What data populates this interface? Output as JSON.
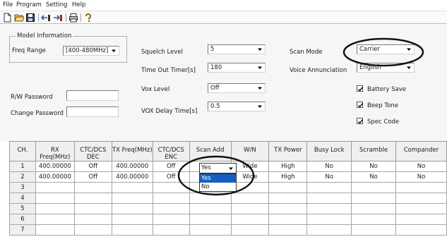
{
  "menu": [
    "File",
    "Program",
    "Setting",
    "Help"
  ],
  "toolbar": {
    "icons": [
      "new-file-icon",
      "open-folder-icon",
      "save-disk-icon",
      "read-from-radio-icon",
      "write-to-radio-icon",
      "print-icon",
      "help-about-icon"
    ]
  },
  "model_info": {
    "legend": "Model Information",
    "freq_range_label": "Freq Range",
    "freq_range_value": "[400-480MHz]"
  },
  "password": {
    "rw_label": "R/W Password",
    "rw_value": "",
    "change_label": "Change Password",
    "change_value": ""
  },
  "settings": {
    "squelch_label": "Squelch Level",
    "squelch_value": "5",
    "timeout_label": "Time Out Timer[s]",
    "timeout_value": "180",
    "vox_level_label": "Vox Level",
    "vox_level_value": "Off",
    "vox_delay_label": "VOX Delay Time[s]",
    "vox_delay_value": "0.5",
    "scan_mode_label": "Scan Mode",
    "scan_mode_value": "Carrier",
    "voice_label": "Voice Annunciation",
    "voice_value": "English"
  },
  "checkboxes": [
    {
      "label": "Battery Save",
      "checked": true
    },
    {
      "label": "Beep Tone",
      "checked": true
    },
    {
      "label": "Spec Code",
      "checked": true
    }
  ],
  "table": {
    "columns": [
      "CH.",
      "RX Freq(MHz)",
      "CTC/DCS DEC",
      "TX Freq(MHz)",
      "CTC/DCS ENC",
      "Scan Add",
      "W/N",
      "TX Power",
      "Busy Lock",
      "Scramble",
      "Compander"
    ],
    "rows": [
      [
        "1",
        "400.00000",
        "Off",
        "400.00000",
        "Off",
        "Yes",
        "Wide",
        "High",
        "No",
        "No",
        "No"
      ],
      [
        "2",
        "400.00000",
        "Off",
        "400.00000",
        "Off",
        "Yes",
        "Wide",
        "High",
        "No",
        "No",
        "No"
      ],
      [
        "3",
        "",
        "",
        "",
        "",
        "",
        "",
        "",
        "",
        "",
        ""
      ],
      [
        "4",
        "",
        "",
        "",
        "",
        "",
        "",
        "",
        "",
        "",
        ""
      ],
      [
        "5",
        "",
        "",
        "",
        "",
        "",
        "",
        "",
        "",
        "",
        ""
      ],
      [
        "6",
        "",
        "",
        "",
        "",
        "",
        "",
        "",
        "",
        "",
        ""
      ],
      [
        "7",
        "",
        "",
        "",
        "",
        "",
        "",
        "",
        "",
        "",
        ""
      ]
    ],
    "active_cell_value": "Yes",
    "dropdown_options": [
      "Yes",
      "No"
    ],
    "dropdown_selected": "Yes"
  },
  "colors": {
    "selection": "#1460c0",
    "annotation": "#111111"
  }
}
